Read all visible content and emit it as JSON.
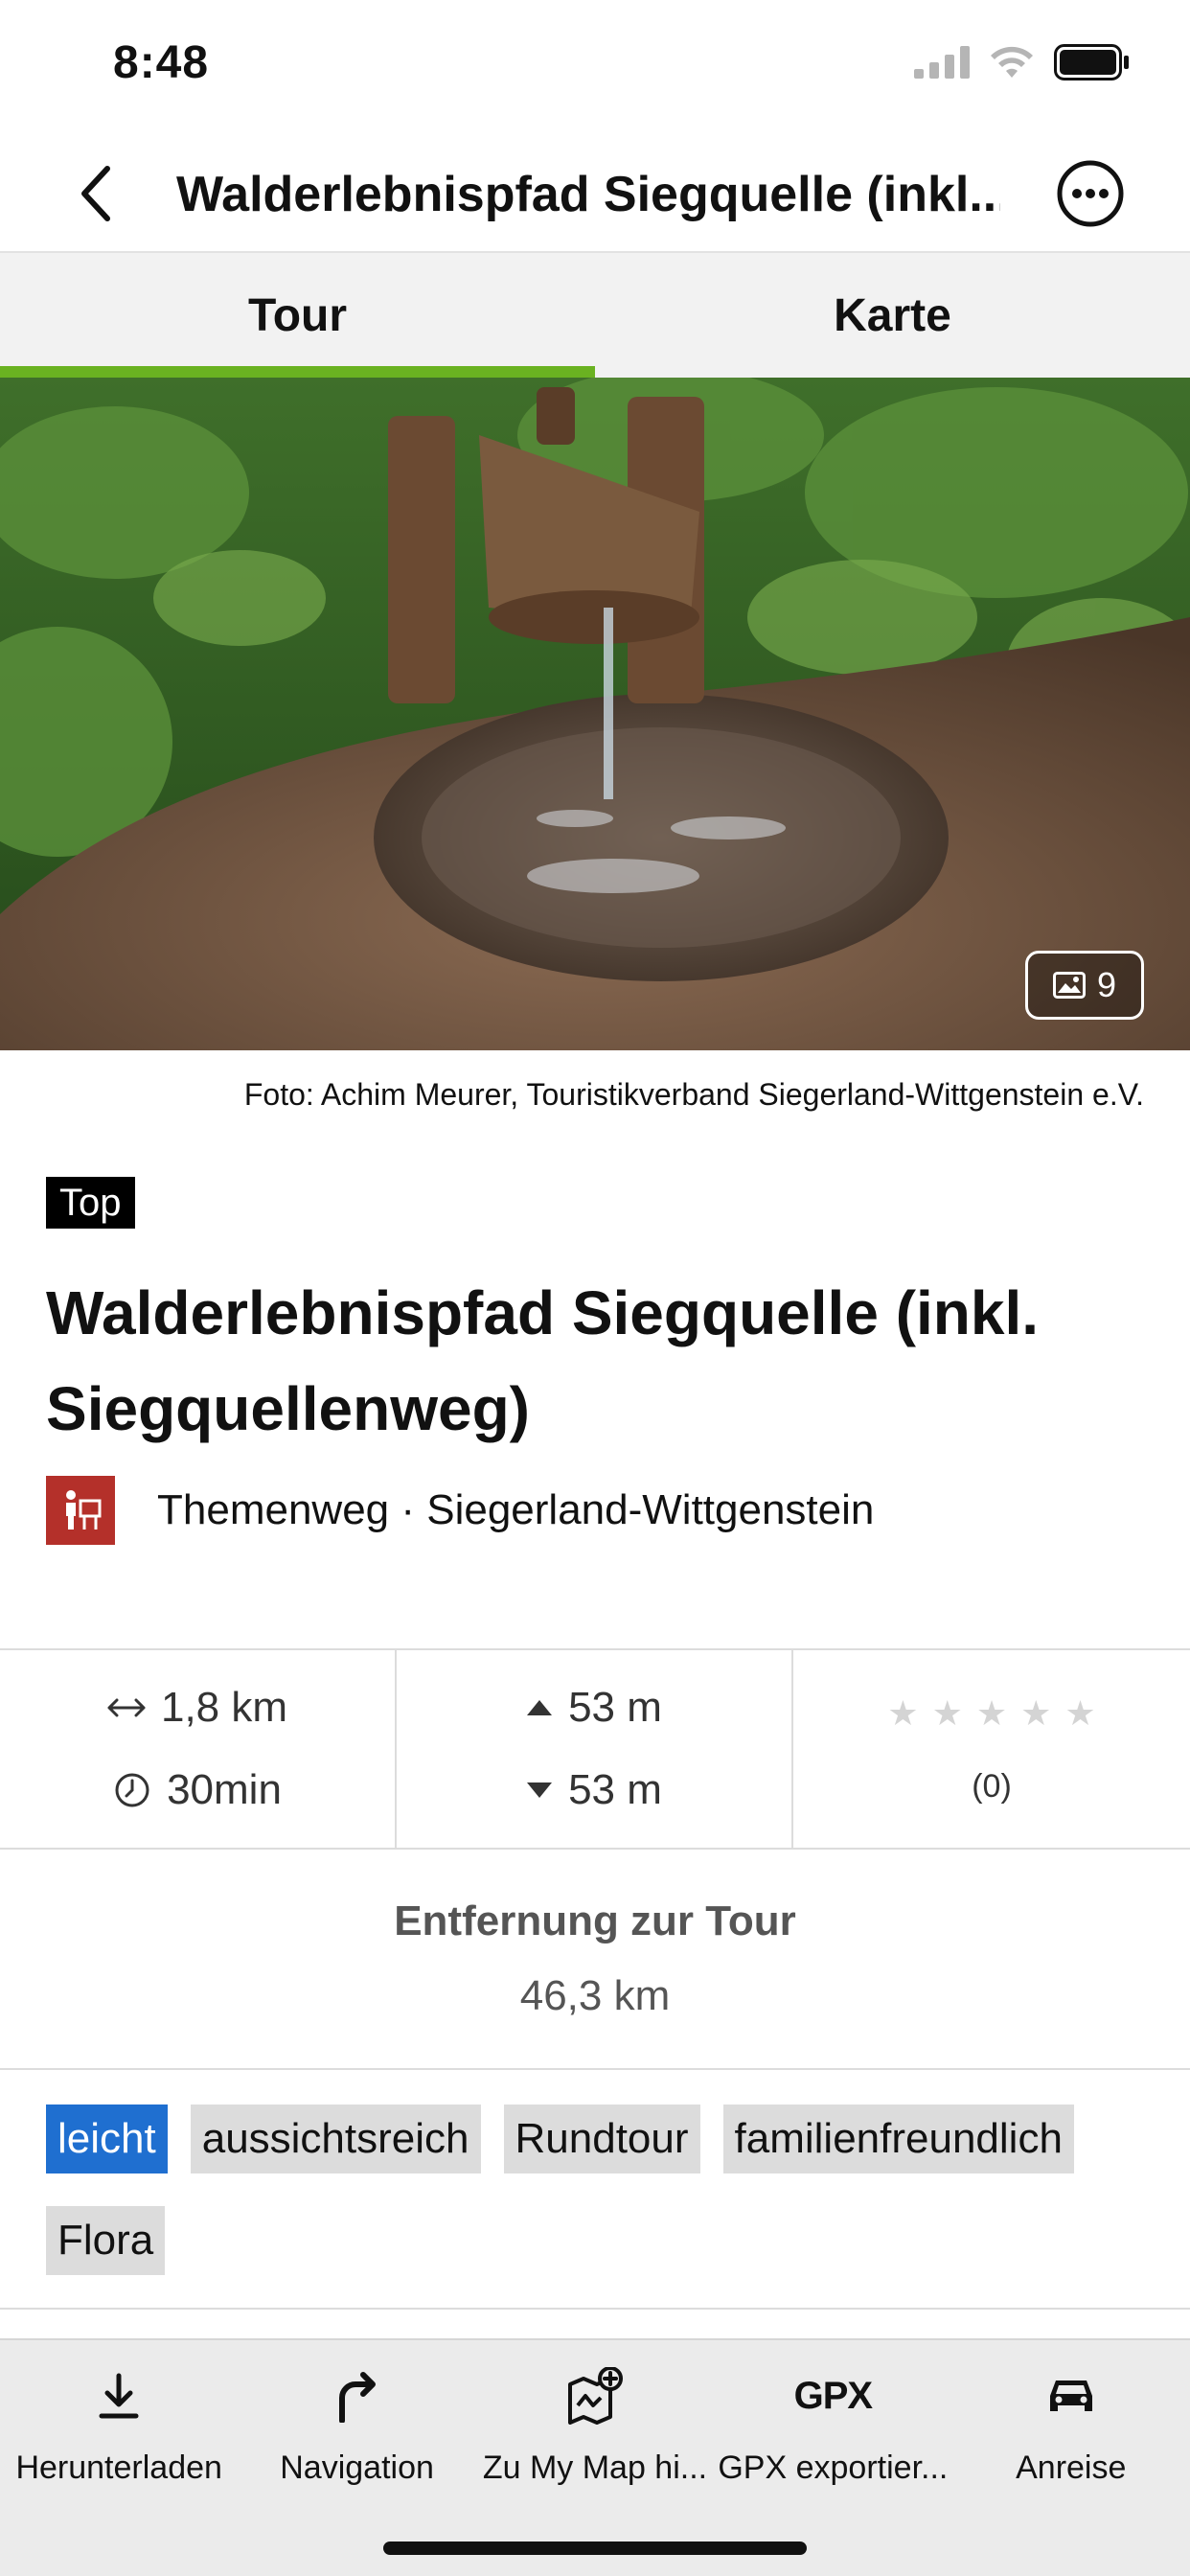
{
  "status_bar": {
    "time": "8:48"
  },
  "header": {
    "title": "Walderlebnispfad Siegquelle (inkl...."
  },
  "tabs": [
    {
      "label": "Tour",
      "active": true
    },
    {
      "label": "Karte",
      "active": false
    }
  ],
  "hero": {
    "photo_count": "9"
  },
  "caption": "Foto: Achim Meurer, Touristikverband Siegerland-Wittgenstein e.V.",
  "badge": "Top",
  "title": "Walderlebnispfad Siegquelle (inkl. Siegquellenweg)",
  "category": "Themenweg · Siegerland-Wittgenstein",
  "stats": {
    "distance": "1,8 km",
    "duration": "30min",
    "ascent": "53 m",
    "descent": "53 m",
    "rating_count": "(0)",
    "rating_value": 0,
    "rating_max": 5
  },
  "distance_to_tour": {
    "label": "Entfernung zur Tour",
    "value": "46,3 km"
  },
  "tags": [
    "leicht",
    "aussichtsreich",
    "Rundtour",
    "familienfreundlich",
    "Flora"
  ],
  "toolbar": [
    {
      "label": "Herunterladen",
      "icon": "download-icon"
    },
    {
      "label": "Navigation",
      "icon": "turn-right-arrow-icon"
    },
    {
      "label": "Zu My Map hi...",
      "icon": "map-add-icon"
    },
    {
      "label": "GPX exportier...",
      "icon": "gpx-icon",
      "icon_text": "GPX"
    },
    {
      "label": "Anreise",
      "icon": "car-icon"
    }
  ],
  "colors": {
    "accent_green": "#6ab221",
    "tag_primary": "#1f6fd0",
    "category_red": "#b4302a"
  }
}
